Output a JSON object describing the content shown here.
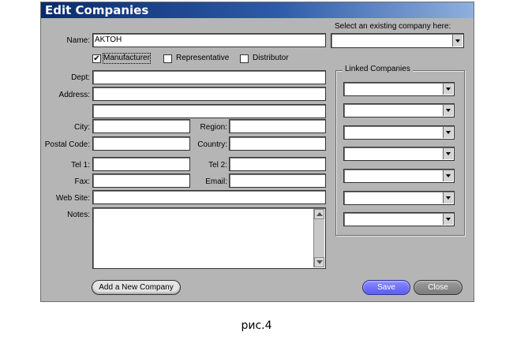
{
  "window": {
    "title": "Edit Companies"
  },
  "form": {
    "name_label": "Name:",
    "name_value": "AKTOH",
    "dept_label": "Dept:",
    "address_label": "Address:",
    "city_label": "City:",
    "region_label": "Region:",
    "postal_label": "Postal Code:",
    "country_label": "Country:",
    "tel1_label": "Tel 1:",
    "tel2_label": "Tel 2:",
    "fax_label": "Fax:",
    "email_label": "Email:",
    "website_label": "Web Site:",
    "notes_label": "Notes:"
  },
  "checkboxes": {
    "manufacturer": {
      "label": "Manufacturer",
      "mark": "✔"
    },
    "representative": {
      "label": "Representative"
    },
    "distributor": {
      "label": "Distributor"
    }
  },
  "existing": {
    "label": "Select an existing company here:"
  },
  "linked": {
    "label": "Linked Companies"
  },
  "buttons": {
    "add": "Add a New Company",
    "save": "Save",
    "close": "Close"
  },
  "caption": "рис.4"
}
